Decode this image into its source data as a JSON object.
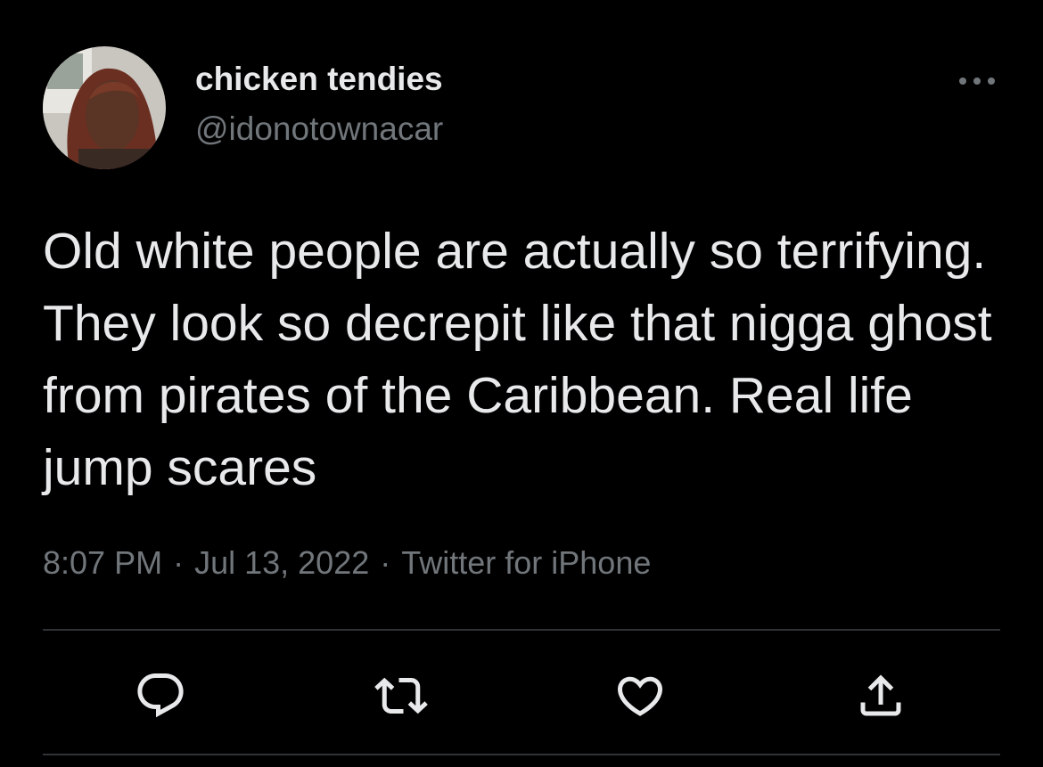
{
  "tweet": {
    "display_name": "chicken tendies",
    "handle": "@idonotownacar",
    "text": "Old white people are actually so terrifying. They look so decrepit like that nigga ghost from pirates of the Caribbean. Real life jump scares",
    "time": "8:07 PM",
    "date": "Jul 13, 2022",
    "source": "Twitter for iPhone",
    "separator": "·"
  },
  "icons": {
    "more": "more-horizontal-icon",
    "reply": "reply-icon",
    "retweet": "retweet-icon",
    "like": "heart-icon",
    "share": "share-icon"
  },
  "colors": {
    "background": "#000000",
    "primary_text": "#e7e9ea",
    "secondary_text": "#71767b",
    "divider": "#2f3336"
  }
}
